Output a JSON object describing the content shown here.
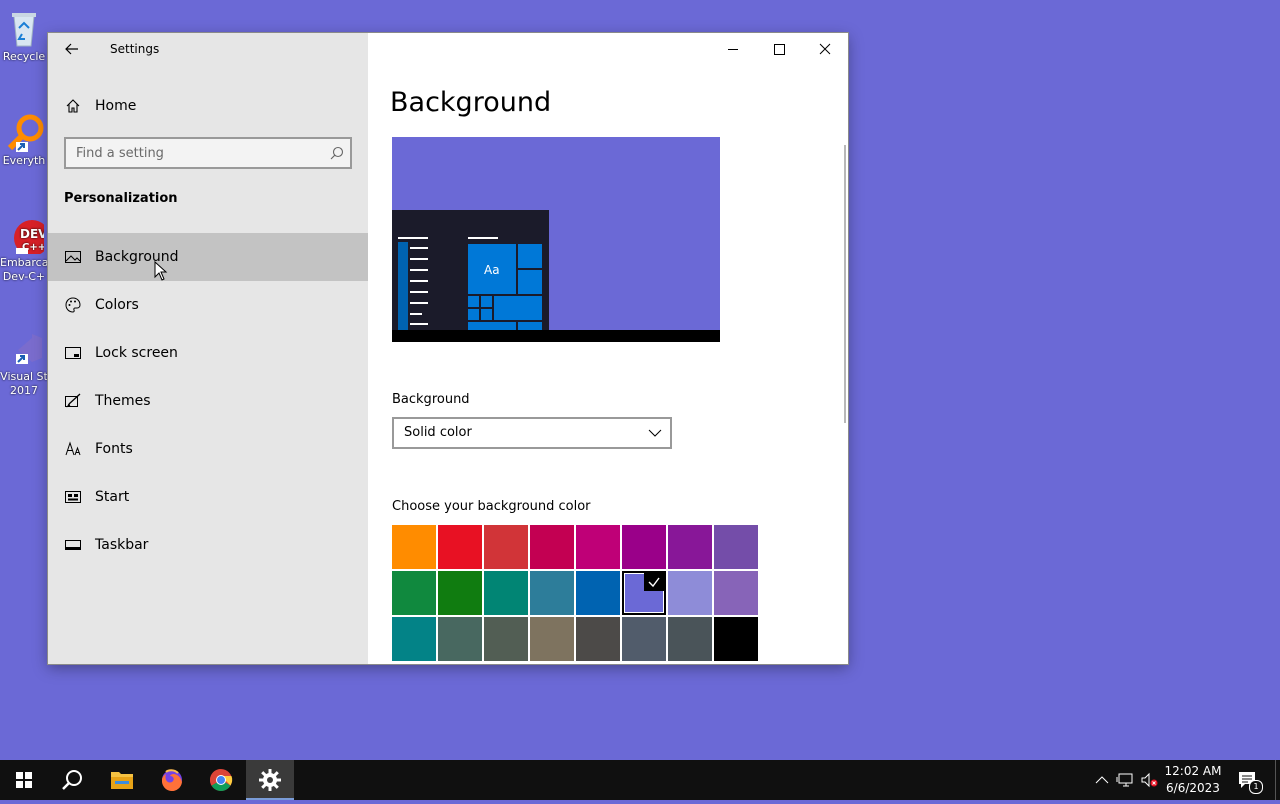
{
  "desktop": {
    "icons": [
      {
        "label": "Recycle",
        "name": "recycle-bin"
      },
      {
        "label": "Everyth",
        "name": "everything"
      },
      {
        "label": "Embarca Dev-C+",
        "name": "embarcadero-devcpp"
      },
      {
        "label": "Visual St 2017",
        "name": "visual-studio"
      }
    ]
  },
  "window": {
    "title": "Settings",
    "back_icon": "arrow-left-icon",
    "home_label": "Home",
    "search": {
      "placeholder": "Find a setting",
      "value": ""
    },
    "section_title": "Personalization",
    "nav_items": [
      {
        "label": "Background",
        "icon": "picture-icon",
        "active": true
      },
      {
        "label": "Colors",
        "icon": "palette-icon",
        "active": false
      },
      {
        "label": "Lock screen",
        "icon": "lock-screen-icon",
        "active": false
      },
      {
        "label": "Themes",
        "icon": "brush-icon",
        "active": false
      },
      {
        "label": "Fonts",
        "icon": "font-icon",
        "active": false
      },
      {
        "label": "Start",
        "icon": "start-icon",
        "active": false
      },
      {
        "label": "Taskbar",
        "icon": "taskbar-icon",
        "active": false
      }
    ]
  },
  "content": {
    "page_title": "Background",
    "preview_tile_text": "Aa",
    "background_label": "Background",
    "background_value": "Solid color",
    "color_label": "Choose your background color",
    "swatches": [
      [
        "#ff8c00",
        "#e81123",
        "#d13438",
        "#c30052",
        "#bf0077",
        "#9a0089",
        "#881798",
        "#744da9"
      ],
      [
        "#10893e",
        "#107c10",
        "#018574",
        "#2d7d9a",
        "#0063b1",
        "#6b69d6",
        "#8e8cd8",
        "#8764b8"
      ],
      [
        "#038387",
        "#486860",
        "#525e54",
        "#7e735f",
        "#4c4a48",
        "#515c6b",
        "#4a5459",
        "#000000"
      ]
    ],
    "selected_swatch": "#6b69d6"
  },
  "taskbar": {
    "time": "12:02 AM",
    "date": "6/6/2023",
    "notification_count": "1"
  }
}
